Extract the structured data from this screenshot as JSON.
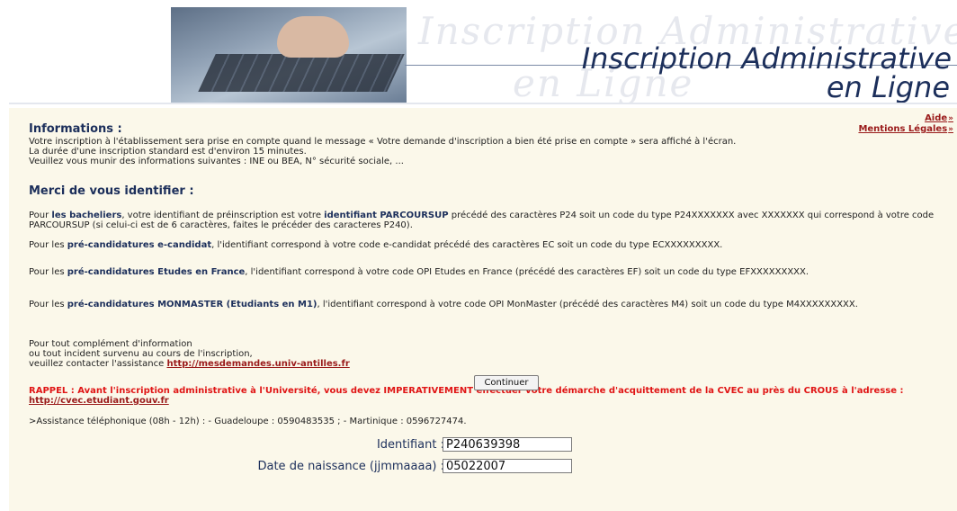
{
  "banner": {
    "title_line1": "Inscription Administrative",
    "title_line2": "en Ligne",
    "watermark_line1": "Inscription Administrative",
    "watermark_line2": "en Ligne"
  },
  "top_links": {
    "help": "Aide",
    "legal": "Mentions Légales"
  },
  "info": {
    "title": "Informations :",
    "line1": "Votre inscription à l'établissement sera prise en compte quand le message « Votre demande d'inscription a bien été prise en compte » sera affiché à l'écran.",
    "line2": "La durée d'une inscription standard est d'environ 15 minutes.",
    "line3": "Veuillez vous munir des informations suivantes : INE ou BEA, N° sécurité sociale, ..."
  },
  "identify": {
    "title": "Merci de vous identifier :",
    "bacheliers_pre": "Pour ",
    "bacheliers_bold": "les bacheliers",
    "bacheliers_mid": ", votre identifiant de préinscription est votre ",
    "bacheliers_bold2": "identifiant PARCOURSUP",
    "bacheliers_post": " précédé des caractères P24 soit un code du type P24XXXXXXX avec XXXXXXX qui correspond à votre code PARCOURSUP (si celui-ci est de 6 caractères, faites le précéder des caracteres P240).",
    "ecandidat_pre": "Pour les ",
    "ecandidat_bold": "pré-candidatures e-candidat",
    "ecandidat_post": ", l'identifiant correspond à votre code e-candidat précédé des caractères EC soit un code du type ECXXXXXXXXX.",
    "eef_pre": "Pour les ",
    "eef_bold": "pré-candidatures Etudes en France",
    "eef_post": ", l'identifiant correspond à votre code OPI Etudes en France (précédé des caractères EF) soit un code du type EFXXXXXXXXX.",
    "mm_pre": "Pour les ",
    "mm_bold": "pré-candidatures MONMASTER (Etudiants en M1)",
    "mm_post": ", l'identifiant correspond à votre code OPI MonMaster (précédé des caractères M4) soit un code du type M4XXXXXXXXX.",
    "contact_line1": "Pour tout complément d'information",
    "contact_line2": "ou tout incident survenu au cours de l'inscription,",
    "contact_line3": "veuillez contacter l'assistance ",
    "contact_link": "http://mesdemandes.univ-antilles.fr"
  },
  "rappel": {
    "text": "RAPPEL : Avant l'inscription administrative à l'Université, vous devez IMPERATIVEMENT effectuer votre démarche d'acquittement de la CVEC au près du CROUS à l'adresse : ",
    "link": "http://cvec.etudiant.gouv.fr"
  },
  "assistance": ">Assistance téléphonique (08h - 12h) : - Guadeloupe : 0590483535 ; - Martinique : 0596727474.",
  "form": {
    "id_label": "Identifiant :",
    "id_value": "P240639398",
    "dob_label": "Date de naissance (jjmmaaaa) :",
    "dob_value": "05022007",
    "submit": "Continuer"
  },
  "colors": {
    "panel_bg": "#fbf8ea",
    "heading": "#1c2f5b",
    "link": "#9a1a1a",
    "alert": "#e01515"
  }
}
